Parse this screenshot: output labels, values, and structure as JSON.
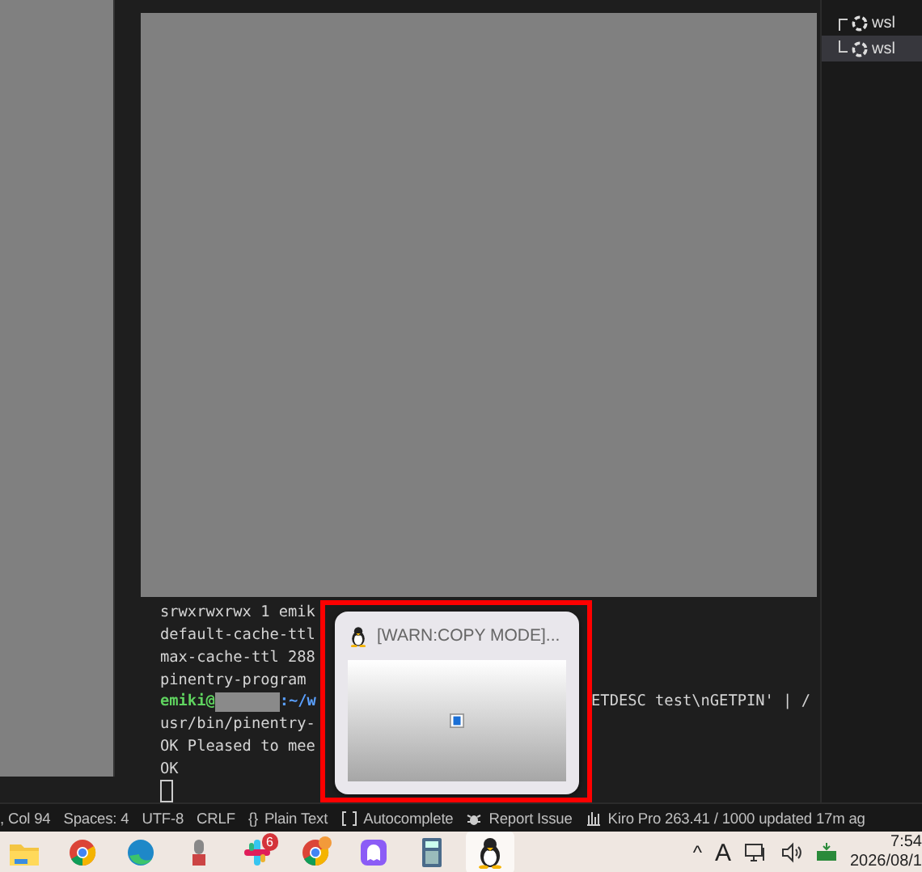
{
  "terminal_tabs": [
    {
      "label": "wsl",
      "selected": false
    },
    {
      "label": "wsl",
      "selected": true
    }
  ],
  "terminal": {
    "lines": [
      {
        "segments": [
          {
            "kind": "text",
            "text": "srwxrwxrwx 1 emik"
          }
        ]
      },
      {
        "segments": [
          {
            "kind": "text",
            "text": "default-cache-ttl"
          }
        ]
      },
      {
        "segments": [
          {
            "kind": "text",
            "text": "max-cache-ttl 288"
          }
        ]
      },
      {
        "segments": [
          {
            "kind": "text",
            "text": "pinentry-program"
          }
        ]
      },
      {
        "segments": [
          {
            "kind": "user",
            "text": "emiki@"
          },
          {
            "kind": "redacted"
          },
          {
            "kind": "path",
            "text": ":~/w"
          }
        ],
        "right": "ETDESC test\\nGETPIN' | /"
      },
      {
        "segments": [
          {
            "kind": "text",
            "text": "usr/bin/pinentry-"
          }
        ]
      },
      {
        "segments": [
          {
            "kind": "text",
            "text": "OK Pleased to mee"
          }
        ]
      },
      {
        "segments": [
          {
            "kind": "text",
            "text": "OK"
          }
        ]
      },
      {
        "segments": [
          {
            "kind": "cursor"
          }
        ]
      }
    ]
  },
  "status_bar": [
    {
      "kind": "text",
      "text": ", Col 94"
    },
    {
      "kind": "text",
      "text": "Spaces: 4"
    },
    {
      "kind": "text",
      "text": "UTF-8"
    },
    {
      "kind": "text",
      "text": "CRLF"
    },
    {
      "kind": "text",
      "glyph": "{}",
      "text": "Plain Text"
    },
    {
      "kind": "autocomplete",
      "text": "Autocomplete"
    },
    {
      "kind": "issue",
      "text": "Report Issue"
    },
    {
      "kind": "usage",
      "text": "Kiro Pro 263.41 / 1000 updated 17m ag"
    }
  ],
  "popup": {
    "title": "[WARN:COPY MODE]..."
  },
  "taskbar": {
    "apps": [
      {
        "kind": "folder",
        "active": false
      },
      {
        "kind": "chrome",
        "active": false
      },
      {
        "kind": "edge",
        "active": false
      },
      {
        "kind": "mic",
        "active": false
      },
      {
        "kind": "slack",
        "active": false,
        "badge": "6"
      },
      {
        "kind": "chrome-profile",
        "active": false
      },
      {
        "kind": "ghost",
        "active": false
      },
      {
        "kind": "calculator",
        "active": false
      },
      {
        "kind": "penguin",
        "active": true
      }
    ],
    "tray": {
      "chevron": "^",
      "input": "A",
      "time": "7:54",
      "date": "2026/08/1"
    }
  }
}
